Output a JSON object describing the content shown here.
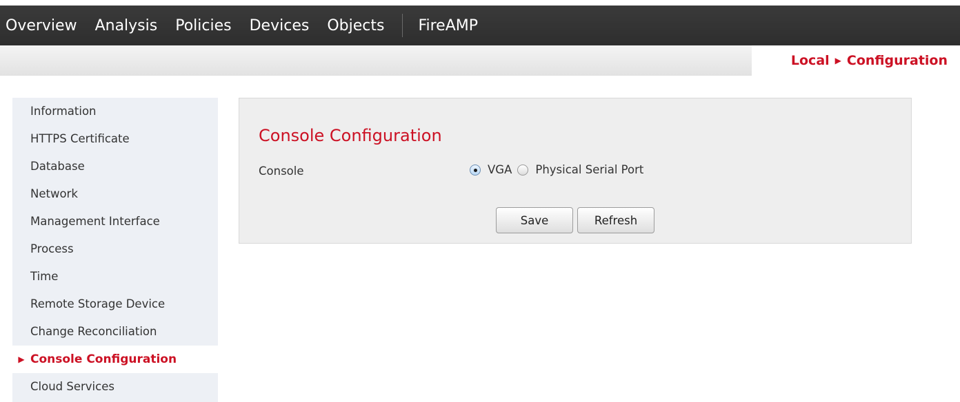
{
  "topnav": {
    "items": [
      "Overview",
      "Analysis",
      "Policies",
      "Devices",
      "Objects"
    ],
    "extra_item": "FireAMP"
  },
  "breadcrumb": {
    "parent": "Local",
    "separator_icon": "triangle-right-icon",
    "current": "Configuration"
  },
  "sidebar": {
    "items": [
      "Information",
      "HTTPS Certificate",
      "Database",
      "Network",
      "Management Interface",
      "Process",
      "Time",
      "Remote Storage Device",
      "Change Reconciliation",
      "Console Configuration",
      "Cloud Services"
    ],
    "active_index": 9,
    "active_icon": "triangle-right-icon"
  },
  "panel": {
    "title": "Console Configuration",
    "field_label": "Console",
    "options": [
      {
        "label": "VGA",
        "selected": true
      },
      {
        "label": "Physical Serial Port",
        "selected": false
      }
    ],
    "save_label": "Save",
    "refresh_label": "Refresh"
  },
  "colors": {
    "accent": "#cc1124",
    "topnav_bg": "#333333",
    "sidebar_bg": "#edf0f5",
    "panel_bg": "#eeeeee"
  }
}
